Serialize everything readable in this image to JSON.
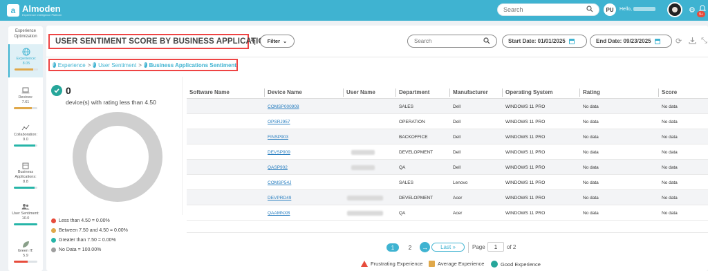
{
  "header": {
    "logo_name": "Almoden",
    "logo_tagline": "Experience Intelligence Platform",
    "search_placeholder": "Search",
    "user_initials": "PU",
    "hello_text": "Hello,",
    "notification_count": "9+"
  },
  "sidebar": {
    "title": "Experience Optimization",
    "items": [
      {
        "label": "Experience:",
        "score": "8.05",
        "bar_color": "#e0a84a",
        "bar_fraction": 0.8,
        "active": true
      },
      {
        "label": "Devices:",
        "score": "7.61",
        "bar_color": "#e0a84a",
        "bar_fraction": 0.76
      },
      {
        "label": "Collaboration:",
        "score": "9.0",
        "bar_color": "#26b5a8",
        "bar_fraction": 0.9
      },
      {
        "label": "Business Applications:",
        "score": "8.8",
        "bar_color": "#26b5a8",
        "bar_fraction": 0.88
      },
      {
        "label": "User Sentiment:",
        "score": "10.0",
        "bar_color": "#26b5a8",
        "bar_fraction": 1.0
      },
      {
        "label": "Green IT:",
        "score": "5.9",
        "bar_color": "#e74c3c",
        "bar_fraction": 0.59
      }
    ]
  },
  "page": {
    "title": "USER SENTIMENT SCORE BY BUSINESS APPLICATIONS",
    "filter_label": "Filter",
    "search_placeholder": "Search",
    "start_date": "Start Date: 01/01/2025",
    "end_date": "End Date: 09/23/2025"
  },
  "breadcrumb": [
    "Experience",
    "User Sentiment",
    "Business Applications Sentiment"
  ],
  "summary": {
    "count": "0",
    "label": "device(s) with rating less than 4.50",
    "legend": [
      {
        "label": "Less than 4.50",
        "value": "= 0.00%",
        "color": "#e74c3c"
      },
      {
        "label": "Between 7.50 and 4.50",
        "value": "= 0.00%",
        "color": "#e0a84a"
      },
      {
        "label": "Greater than 7.50",
        "value": "= 0.00%",
        "color": "#26b5a8"
      },
      {
        "label": "No Data",
        "value": "= 100.00%",
        "color": "#9e9e9e"
      }
    ]
  },
  "chart_data": {
    "type": "pie",
    "categories": [
      "Less than 4.50",
      "Between 7.50 and 4.50",
      "Greater than 7.50",
      "No Data"
    ],
    "values": [
      0,
      0,
      0,
      100
    ]
  },
  "table": {
    "columns": [
      "Software Name",
      "Device Name",
      "User Name",
      "Department",
      "Manufacturer",
      "Operating System",
      "Rating",
      "Score"
    ],
    "rows": [
      {
        "software": "",
        "device": "COMSP000908",
        "user": "",
        "department": "SALES",
        "manufacturer": "Dell",
        "os": "WINDOWS 11 PRO",
        "rating": "No data",
        "score": "No data"
      },
      {
        "software": "",
        "device": "OPSRJ957",
        "user": "",
        "department": "OPERATION",
        "manufacturer": "Dell",
        "os": "WINDOWS 11 PRO",
        "rating": "No data",
        "score": "No data"
      },
      {
        "software": "",
        "device": "FINSP903",
        "user": "",
        "department": "BACKOFFICE",
        "manufacturer": "Dell",
        "os": "WINDOWS 11 PRO",
        "rating": "No data",
        "score": "No data"
      },
      {
        "software": "",
        "device": "DEVSP909",
        "user": "",
        "department": "DEVELOPMENT",
        "manufacturer": "Dell",
        "os": "WINDOWS 11 PRO",
        "rating": "No data",
        "score": "No data"
      },
      {
        "software": "",
        "device": "QASP902",
        "user": "",
        "department": "QA",
        "manufacturer": "Dell",
        "os": "WINDOWS 11 PRO",
        "rating": "No data",
        "score": "No data"
      },
      {
        "software": "",
        "device": "COMSP54J",
        "user": "",
        "department": "SALES",
        "manufacturer": "Lenovo",
        "os": "WINDOWS 11 PRO",
        "rating": "No data",
        "score": "No data"
      },
      {
        "software": "",
        "device": "DEVPRD49",
        "user": "",
        "department": "DEVELOPMENT",
        "manufacturer": "Acer",
        "os": "WINDOWS 11 PRO",
        "rating": "No data",
        "score": "No data"
      },
      {
        "software": "",
        "device": "QAAMNXB",
        "user": "",
        "department": "QA",
        "manufacturer": "Acer",
        "os": "WINDOWS 11 PRO",
        "rating": "No data",
        "score": "No data"
      }
    ]
  },
  "pagination": {
    "current": "1",
    "next_page": "2",
    "last_label": "Last »",
    "page_label": "Page",
    "page_value": "1",
    "of_label": "of 2"
  },
  "experience_legend": [
    {
      "label": "Frustrating Experience",
      "icon": "warning-triangle-icon"
    },
    {
      "label": "Average Experience",
      "icon": "average-bars-icon"
    },
    {
      "label": "Good Experience",
      "icon": "good-check-icon"
    }
  ]
}
